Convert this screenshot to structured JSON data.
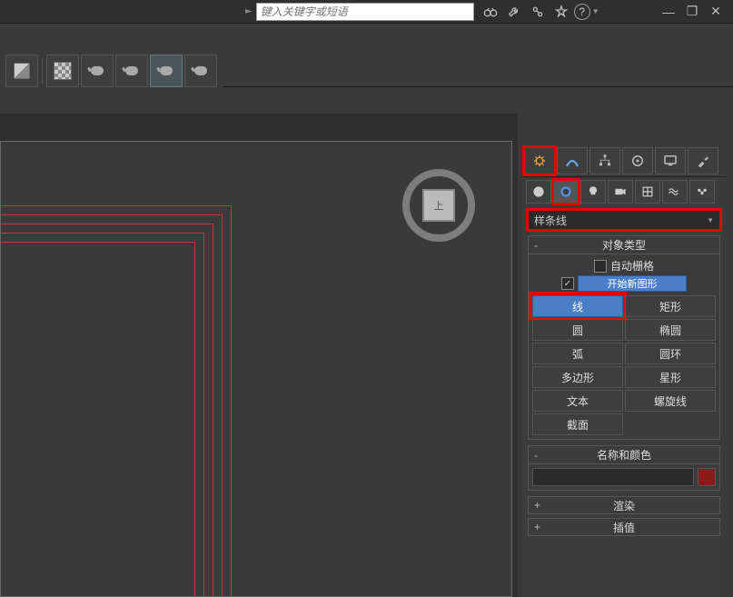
{
  "search": {
    "placeholder": "键入关键字或短语"
  },
  "viewcube": {
    "face": "上"
  },
  "panel": {
    "dropdown_value": "样条线",
    "object_type_header": "对象类型",
    "auto_grid_label": "自动栅格",
    "start_new_shape_label": "开始新图形",
    "buttons": {
      "line": "线",
      "rectangle": "矩形",
      "circle": "圆",
      "ellipse": "椭圆",
      "arc": "弧",
      "donut": "圆环",
      "ngon": "多边形",
      "star": "星形",
      "text": "文本",
      "helix": "螺旋线",
      "section": "截面"
    },
    "name_color_header": "名称和颜色",
    "render_header": "渲染",
    "interp_header": "插值"
  }
}
